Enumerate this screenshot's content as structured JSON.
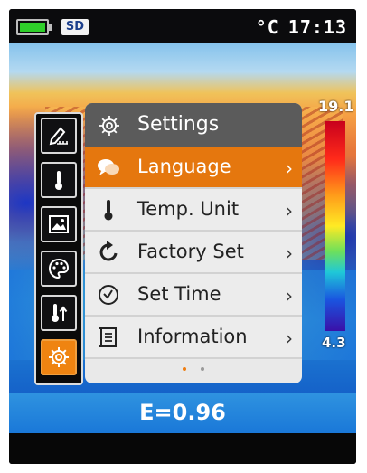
{
  "status": {
    "sd_label": "SD",
    "unit": "°C",
    "time": "17:13",
    "battery_color": "#2fcf2a"
  },
  "scale": {
    "max": "19.1",
    "min": "4.3"
  },
  "sidebar": {
    "items": [
      {
        "icon": "image-edit-icon"
      },
      {
        "icon": "thermometer-icon"
      },
      {
        "icon": "picture-icon"
      },
      {
        "icon": "palette-icon"
      },
      {
        "icon": "temperature-alarm-icon"
      },
      {
        "icon": "gear-icon",
        "active": true
      }
    ]
  },
  "menu": {
    "title": "Settings",
    "items": [
      {
        "label": "Language",
        "icon": "speech-bubbles-icon",
        "selected": true
      },
      {
        "label": "Temp. Unit",
        "icon": "thermometer-icon"
      },
      {
        "label": "Factory Set",
        "icon": "reset-arrow-icon"
      },
      {
        "label": "Set Time",
        "icon": "clock-icon"
      },
      {
        "label": "Information",
        "icon": "document-icon"
      }
    ],
    "chevron": "›",
    "page_count": 2,
    "current_page": 1
  },
  "emissivity": "E=0.96",
  "colors": {
    "accent": "#e5770e",
    "panel_header": "#5b5b5b",
    "emissivity_bar": "#1a78d8"
  }
}
